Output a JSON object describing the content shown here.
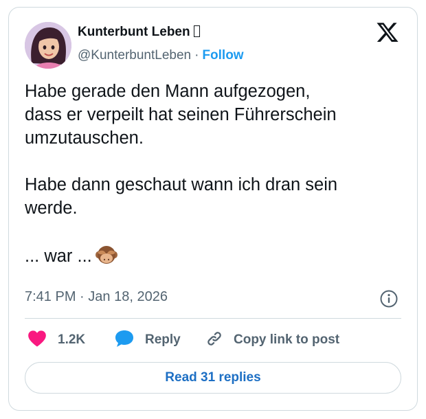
{
  "author": {
    "name": "Kunterbunt Leben",
    "handle": "@KunterbuntLeben",
    "separator": "·",
    "follow_label": "Follow"
  },
  "tweet": {
    "line1": "Habe gerade den Mann aufgezogen,",
    "line2": "dass er verpeilt hat seinen Führerschein",
    "line3": "umzutauschen.",
    "line4": "Habe dann geschaut wann ich dran sein",
    "line5": "werde.",
    "line6": "... war ...",
    "emoji": "see-no-evil-monkey-icon"
  },
  "meta": {
    "time": "7:41 PM",
    "separator": "·",
    "date": "Jan 18, 2026"
  },
  "actions": {
    "likes": "1.2K",
    "reply": "Reply",
    "copy_link": "Copy link to post",
    "read_replies": "Read 31 replies"
  },
  "colors": {
    "accent": "#1d9bf0",
    "heart": "#f91880",
    "reply_bubble": "#1d9bf0",
    "text": "#0f1419",
    "muted": "#536471",
    "border": "#cfd9de"
  }
}
